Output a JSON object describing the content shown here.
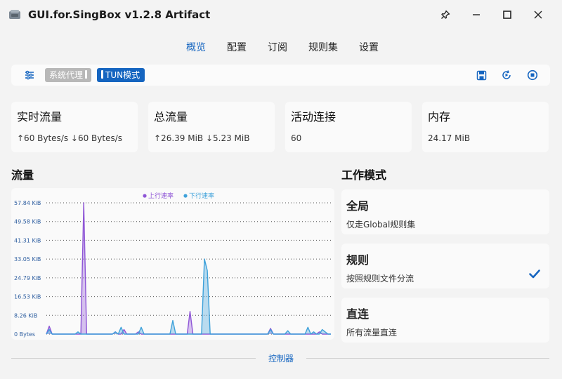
{
  "window": {
    "title": "GUI.for.SingBox v1.2.8 Artifact",
    "buttons": [
      "pin",
      "minimize",
      "maximize",
      "close"
    ]
  },
  "nav": {
    "tabs": [
      {
        "label": "概览",
        "active": true
      },
      {
        "label": "配置",
        "active": false
      },
      {
        "label": "订阅",
        "active": false
      },
      {
        "label": "规则集",
        "active": false
      },
      {
        "label": "设置",
        "active": false
      }
    ]
  },
  "toolbar": {
    "system_proxy_label": "系统代理",
    "system_proxy_on": false,
    "tun_label": "TUN模式",
    "tun_on": true,
    "icons": [
      "settings-sliders-icon",
      "save-icon",
      "restart-icon",
      "stop-icon"
    ]
  },
  "stats": [
    {
      "title": "实时流量",
      "value": "↑60 Bytes/s ↓60 Bytes/s"
    },
    {
      "title": "总流量",
      "value": "↑26.39 MiB ↓5.23 MiB"
    },
    {
      "title": "活动连接",
      "value": "60"
    },
    {
      "title": "内存",
      "value": "24.17 MiB"
    }
  ],
  "traffic": {
    "title": "流量"
  },
  "chart_data": {
    "type": "area",
    "series": [
      {
        "name": "上行速率",
        "color": "#8e55d6",
        "values": [
          0,
          3.5,
          0,
          0,
          0,
          0,
          0,
          0,
          0,
          0,
          0,
          0,
          0,
          57.84,
          0,
          0,
          0,
          0,
          0,
          0,
          0,
          0,
          0,
          0,
          1,
          0,
          0,
          2,
          0,
          0,
          0,
          0,
          1,
          0,
          0,
          0,
          0,
          0,
          0,
          0,
          0,
          0,
          0,
          0,
          0,
          0,
          0,
          0,
          0,
          0,
          10,
          0,
          0,
          0,
          0,
          0,
          0,
          0,
          0,
          0,
          0,
          0,
          0,
          0,
          0,
          0,
          0,
          0,
          0,
          0,
          0,
          0,
          0,
          0,
          0,
          0,
          0,
          0,
          2.5,
          0,
          0,
          0,
          0,
          0,
          0,
          0,
          0,
          0,
          0,
          0,
          0,
          0,
          0,
          0,
          0,
          1,
          0,
          0,
          0,
          0
        ]
      },
      {
        "name": "下行速率",
        "color": "#3ea1da",
        "values": [
          0,
          2,
          0,
          0,
          0,
          0,
          0,
          0,
          0,
          0,
          0,
          1,
          0,
          0,
          0,
          0,
          0,
          0,
          0,
          0,
          0,
          0,
          0,
          0,
          1,
          0,
          3,
          0,
          0,
          0,
          0,
          0,
          0,
          3,
          0,
          0,
          0,
          0,
          0,
          0,
          0,
          0,
          0,
          0,
          6,
          0,
          0,
          0,
          0,
          0,
          0,
          0,
          0,
          0,
          0,
          33.05,
          28,
          0,
          0,
          0,
          0,
          0,
          0,
          0,
          0,
          0,
          0,
          0,
          0,
          0,
          0,
          0,
          0,
          0,
          0,
          0,
          0,
          0,
          2,
          0,
          0,
          0,
          0,
          0,
          1.5,
          0,
          0,
          0,
          0,
          0,
          0,
          3,
          0,
          1,
          0,
          0,
          2,
          1,
          0,
          0
        ]
      }
    ],
    "y_ticks": [
      "0 Bytes",
      "8.26 KiB",
      "16.53 KiB",
      "24.79 KiB",
      "33.05 KiB",
      "41.31 KiB",
      "49.58 KiB",
      "57.84 KiB"
    ],
    "ylim": [
      0,
      57.84
    ],
    "y_unit": "KiB",
    "grid": "dotted-horizontal",
    "legend": "top-center"
  },
  "mode": {
    "title": "工作模式",
    "options": [
      {
        "title": "全局",
        "desc": "仅走Global规则集",
        "selected": false
      },
      {
        "title": "规则",
        "desc": "按照规则文件分流",
        "selected": true
      },
      {
        "title": "直连",
        "desc": "所有流量直连",
        "selected": false
      }
    ]
  },
  "footer": {
    "label": "控制器"
  },
  "colors": {
    "accent": "#1565c0",
    "upload": "#8e55d6",
    "download": "#3ea1da",
    "proxy_off": "#b8b8b8"
  }
}
